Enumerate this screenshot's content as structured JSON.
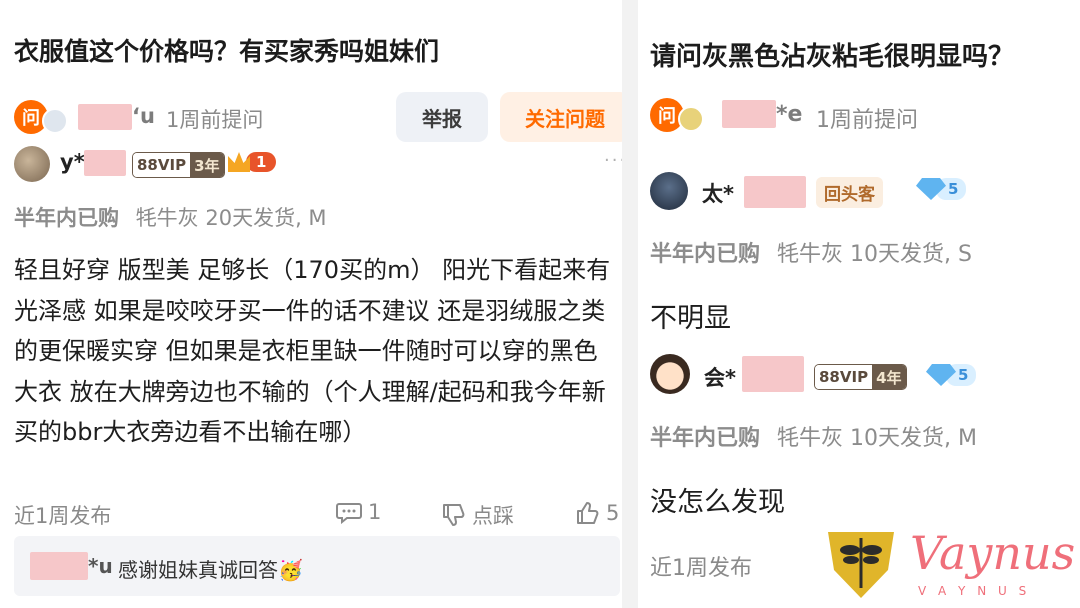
{
  "left": {
    "title": "衣服值这个价格吗？有买家秀吗姐妹们",
    "asker": {
      "badge": "问",
      "name_suffix": "‘u",
      "time": "1周前提问"
    },
    "buttons": {
      "report": "举报",
      "follow": "关注问题"
    },
    "answer": {
      "user": "y*",
      "vip_label": "88VIP",
      "vip_years": "3年",
      "crown_level": "1",
      "purchase_prefix": "半年内已购",
      "purchase_detail": "牦牛灰 20天发货, M",
      "content": "轻且好穿 版型美 足够长（170买的m） 阳光下看起来有光泽感 如果是咬咬牙买一件的话不建议 还是羽绒服之类的更保暖实穿 但如果是衣柜里缺一件随时可以穿的黑色大衣 放在大牌旁边也不输的（个人理解/起码和我今年新买的bbr大衣旁边看不出输在哪）",
      "posted": "近1周发布",
      "comment_count": "1",
      "dislike_label": "点踩",
      "like_count": "5"
    },
    "reply": {
      "name_suffix": "*u",
      "text": "感谢姐妹真诚回答🥳"
    }
  },
  "right": {
    "title": "请问灰黑色沾灰粘毛很明显吗？",
    "asker": {
      "badge": "问",
      "name_suffix": "*e",
      "time": "1周前提问"
    },
    "answers": [
      {
        "user": "太*",
        "tag": "回头客",
        "gem_level": "5",
        "purchase_prefix": "半年内已购",
        "purchase_detail": "牦牛灰 10天发货, S",
        "content": "不明显"
      },
      {
        "user": "会*",
        "vip_label": "88VIP",
        "vip_years": "4年",
        "gem_level": "5",
        "purchase_prefix": "半年内已购",
        "purchase_detail": "牦牛灰 10天发货, M",
        "content": "没怎么发现",
        "posted": "近1周发布"
      }
    ]
  },
  "watermark": {
    "brand": "Vaynus",
    "sub": "V A Y N U S"
  },
  "colors": {
    "accent_orange": "#ff6a00",
    "redaction_pink": "#f6c7c9",
    "watermark": "#e0b52a"
  }
}
